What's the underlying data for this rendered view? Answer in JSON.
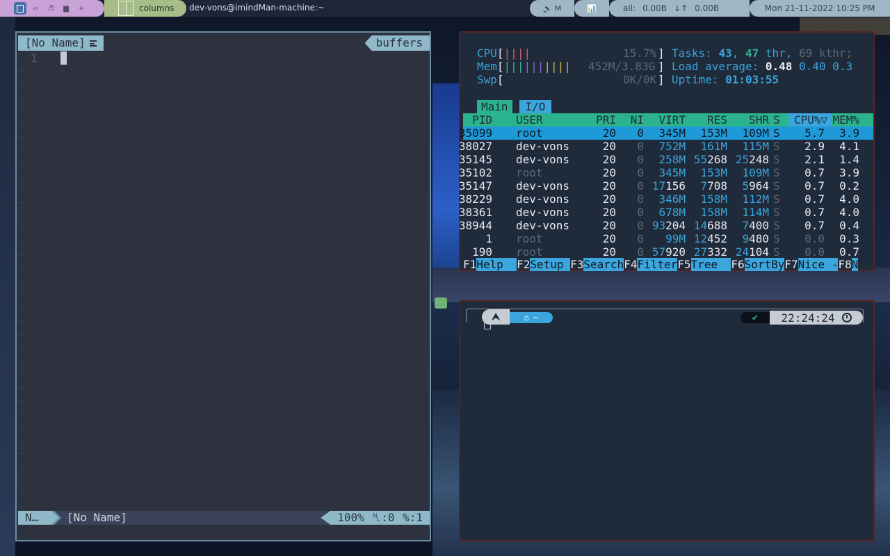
{
  "topbar": {
    "workspaces": [
      "▣",
      "‹›",
      "♬",
      "▆",
      "+"
    ],
    "layout_name": "columns",
    "window_title": "dev-vons@imindMan-machine:~",
    "volume_label": "🔈 M",
    "graph_label": "📊",
    "net_label": "all:",
    "net_down": "0.00B",
    "net_arrows": "↓↑",
    "net_up": "0.00B",
    "datetime": "Mon 21-11-2022 10:25 PM"
  },
  "vim": {
    "tab_name": "[No Name]",
    "buffers_label": "buffers",
    "line_number": "1",
    "tilde": "~",
    "mode": "N…",
    "status_file": "[No Name]",
    "status_right": "100% ␤:0 %:1"
  },
  "htop": {
    "cpu_label": "CPU",
    "cpu_bars": "||||",
    "cpu_value": "15.7%",
    "mem_label": "Mem",
    "mem_bars": "||||||||||",
    "mem_value": "452M/3.83G",
    "swp_label": "Swp",
    "swp_value": "0K/0K",
    "tasks_label": "Tasks:",
    "tasks_count": "43",
    "threads": "47",
    "thr_label": "thr",
    "kthreads": "69 kthr;",
    "load_label": "Load average:",
    "load1": "0.48",
    "load5": "0.40",
    "load15": "0.3",
    "uptime_label": "Uptime:",
    "uptime_value": "01:03:55",
    "tabs": [
      "Main",
      "I/O"
    ],
    "columns": [
      "PID",
      "USER",
      "PRI",
      "NI",
      "VIRT",
      "RES",
      "SHR",
      "S",
      "CPU%▽",
      "MEM%"
    ],
    "processes": [
      {
        "pid": "35099",
        "user": "root",
        "pri": "20",
        "ni": "0",
        "virt": "345M",
        "res": "153M",
        "shr": "109M",
        "s": "S",
        "cpu": "5.7",
        "mem": "3.9"
      },
      {
        "pid": "38027",
        "user": "dev-vons",
        "pri": "20",
        "ni": "0",
        "virt": "752M",
        "res": "161M",
        "shr": "115M",
        "s": "S",
        "cpu": "2.9",
        "mem": "4.1"
      },
      {
        "pid": "35145",
        "user": "dev-vons",
        "pri": "20",
        "ni": "0",
        "virt": "258M",
        "res": "55268",
        "shr": "25248",
        "s": "S",
        "cpu": "2.1",
        "mem": "1.4"
      },
      {
        "pid": "35102",
        "user": "root",
        "pri": "20",
        "ni": "0",
        "virt": "345M",
        "res": "153M",
        "shr": "109M",
        "s": "S",
        "cpu": "0.7",
        "mem": "3.9"
      },
      {
        "pid": "35147",
        "user": "dev-vons",
        "pri": "20",
        "ni": "0",
        "virt": "17156",
        "res": "7708",
        "shr": "5964",
        "s": "S",
        "cpu": "0.7",
        "mem": "0.2"
      },
      {
        "pid": "38229",
        "user": "dev-vons",
        "pri": "20",
        "ni": "0",
        "virt": "346M",
        "res": "158M",
        "shr": "112M",
        "s": "S",
        "cpu": "0.7",
        "mem": "4.0"
      },
      {
        "pid": "38361",
        "user": "dev-vons",
        "pri": "20",
        "ni": "0",
        "virt": "678M",
        "res": "158M",
        "shr": "114M",
        "s": "S",
        "cpu": "0.7",
        "mem": "4.0"
      },
      {
        "pid": "38944",
        "user": "dev-vons",
        "pri": "20",
        "ni": "0",
        "virt": "93204",
        "res": "14688",
        "shr": "7400",
        "s": "S",
        "cpu": "0.7",
        "mem": "0.4"
      },
      {
        "pid": "1",
        "user": "root",
        "pri": "20",
        "ni": "0",
        "virt": "99M",
        "res": "12452",
        "shr": "9480",
        "s": "S",
        "cpu": "0.0",
        "mem": "0.3"
      },
      {
        "pid": "190",
        "user": "root",
        "pri": "20",
        "ni": "0",
        "virt": "57920",
        "res": "27332",
        "shr": "24104",
        "s": "S",
        "cpu": "0.0",
        "mem": "0.7"
      }
    ],
    "fkeys": [
      {
        "key": "F1",
        "label": "Help  "
      },
      {
        "key": "F2",
        "label": "Setup "
      },
      {
        "key": "F3",
        "label": "Search"
      },
      {
        "key": "F4",
        "label": "Filter"
      },
      {
        "key": "F5",
        "label": "Tree  "
      },
      {
        "key": "F6",
        "label": "SortBy"
      },
      {
        "key": "F7",
        "label": "Nice -"
      },
      {
        "key": "F8",
        "label": "N"
      }
    ]
  },
  "terminal": {
    "arch_glyph": "⮝",
    "dir_label": "~",
    "status_icon": "✔",
    "time": "22:24:24"
  }
}
